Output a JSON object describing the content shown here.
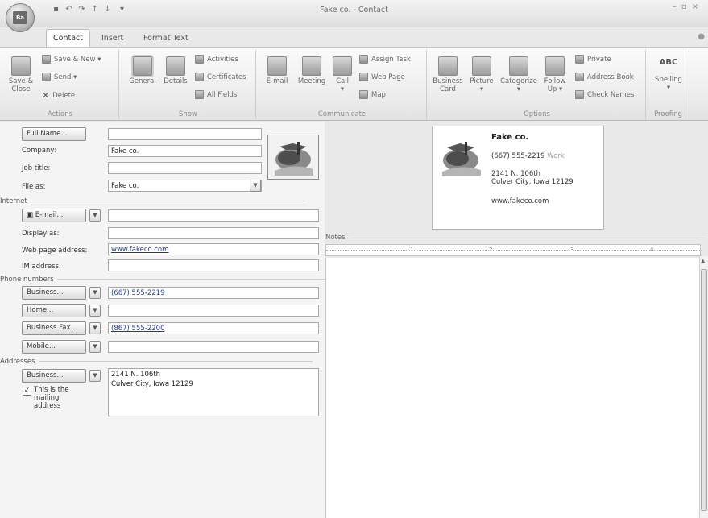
{
  "window": {
    "title": "Fake co. - Contact",
    "office_logo": "Ba"
  },
  "tabs": [
    "Contact",
    "Insert",
    "Format Text"
  ],
  "ribbon": {
    "actions": {
      "save_close": "Save & Close",
      "save_new": "Save & New",
      "send": "Send",
      "delete": "Delete",
      "group_label": "Actions"
    },
    "show": {
      "general": "General",
      "details": "Details",
      "activities": "Activities",
      "certificates": "Certificates",
      "all_fields": "All Fields",
      "group_label": "Show"
    },
    "communicate": {
      "email": "E-mail",
      "meeting": "Meeting",
      "call": "Call",
      "assign_task": "Assign Task",
      "web_page": "Web Page",
      "map": "Map",
      "group_label": "Communicate"
    },
    "options": {
      "business_card": "Business Card",
      "picture": "Picture",
      "categorize": "Categorize",
      "follow_up": "Follow Up",
      "private": "Private",
      "address_book": "Address Book",
      "check_names": "Check Names",
      "group_label": "Options"
    },
    "proofing": {
      "spelling": "Spelling",
      "abc": "ABC",
      "group_label": "Proofing"
    }
  },
  "form": {
    "full_name_btn": "Full Name...",
    "full_name": "",
    "company_label": "Company:",
    "company": "Fake co.",
    "job_title_label": "Job title:",
    "job_title": "",
    "file_as_label": "File as:",
    "file_as": "Fake co.",
    "internet_section": "Internet",
    "email_btn": "E-mail...",
    "email": "",
    "display_as_label": "Display as:",
    "display_as": "",
    "web_label": "Web page address:",
    "web": "www.fakeco.com",
    "im_label": "IM address:",
    "im": "",
    "phone_section": "Phone numbers",
    "phones": [
      {
        "label": "Business...",
        "value": "(667) 555-2219"
      },
      {
        "label": "Home...",
        "value": ""
      },
      {
        "label": "Business Fax...",
        "value": "(867) 555-2200"
      },
      {
        "label": "Mobile...",
        "value": ""
      }
    ],
    "address_section": "Addresses",
    "address_btn": "Business...",
    "address_line1": "2141 N. 106th",
    "address_line2": "Culver City, Iowa  12129",
    "mailing_checkbox": "This is the mailing address",
    "mailing_checked": true
  },
  "card": {
    "name": "Fake co.",
    "phone": "(667) 555-2219",
    "phone_type": "Work",
    "addr1": "2141 N. 106th",
    "addr2": "Culver City, Iowa  12129",
    "web": "www.fakeco.com"
  },
  "notes": {
    "label": "Notes",
    "ruler": [
      "1",
      "2",
      "3",
      "4"
    ]
  }
}
